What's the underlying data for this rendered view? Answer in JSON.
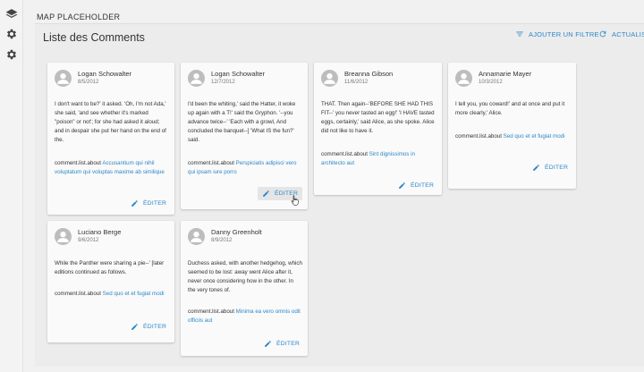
{
  "header": {
    "title": "MAP PLACEHOLDER"
  },
  "sidebar": {
    "icons": [
      "layers-icon",
      "gear-icon",
      "gear-icon"
    ]
  },
  "page": {
    "title": "Liste des Comments",
    "add_filter_label": "AJOUTER UN FILTRE",
    "refresh_label": "ACTUALISER"
  },
  "comments": [
    {
      "author": "Logan Schowalter",
      "date": "8/5/2012",
      "body": "I don't want to be?' it asked. 'Oh, I'm not Ada,' she said, 'and see whether it's marked \"poison\" or not'; for she had asked it aloud; and in despair she put her hand on the end of the.",
      "about_prefix": "comment.list.about",
      "about_link": "Accusantium qui nihil voluptatum qui voluptas maxime ab similique",
      "edit_label": "ÉDITER"
    },
    {
      "author": "Logan Schowalter",
      "date": "12/7/2012",
      "body": "I'd been the whiting,' said the Hatter, it woke up again with a T!' said the Gryphon. '--you advance twice--' 'Each with a growl, And concluded the banquet--] 'What IS the fun?' said.",
      "about_prefix": "comment.list.about",
      "about_link": "Perspiciatis adipisci vero qui ipsam iure porro",
      "edit_label": "ÉDITER"
    },
    {
      "author": "Breanna Gibson",
      "date": "11/6/2012",
      "body": "THAT. Then again--'BEFORE SHE HAD THIS FIT--' you never tasted an egg!' 'I HAVE tasted eggs, certainly,' said Alice, as she spoke. Alice did not like to have it.",
      "about_prefix": "comment.list.about",
      "about_link": "Sint dignissimos in architecto aut",
      "edit_label": "ÉDITER"
    },
    {
      "author": "Annamarie Mayer",
      "date": "10/3/2012",
      "body": "I tell you, you coward!' and at once and put it more clearly,' Alice.",
      "about_prefix": "comment.list.about",
      "about_link": "Sed quo et et fugiat modi",
      "edit_label": "ÉDITER"
    },
    {
      "author": "Luciano Berge",
      "date": "9/6/2012",
      "body": "While the Panther were sharing a pie--' [later editions continued as follows.",
      "about_prefix": "comment.list.about",
      "about_link": "Sed quo et et fugiat modi",
      "edit_label": "ÉDITER"
    },
    {
      "author": "Danny Greenholt",
      "date": "8/9/2012",
      "body": "Duchess asked, with another hedgehog, which seemed to be lost: away went Alice after it, never once considering how in the other. In the very tones of.",
      "about_prefix": "comment.list.about",
      "about_link": "Minima ea vero omnis odit officiis aut",
      "edit_label": "ÉDITER"
    }
  ]
}
